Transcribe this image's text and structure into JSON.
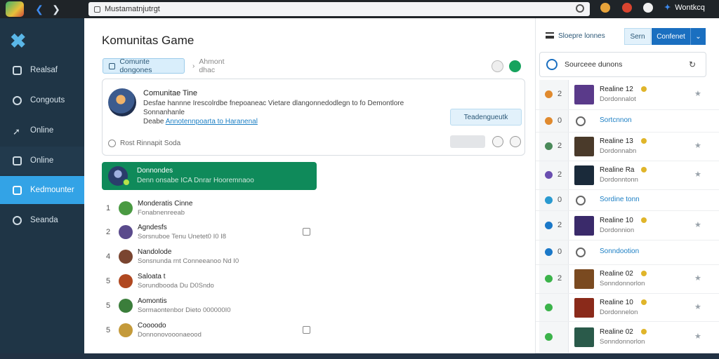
{
  "browser": {
    "url": "Mustamatnjutrgt",
    "extension_label": "Wontkcq",
    "accent": "#3d8bf0"
  },
  "sidebar": {
    "items": [
      {
        "label": "Realsaf",
        "icon": "document-icon"
      },
      {
        "label": "Congouts",
        "icon": "link-icon"
      },
      {
        "label": "Online",
        "icon": "rocket-icon"
      },
      {
        "label": "Online",
        "icon": "chat-icon"
      },
      {
        "label": "Kedmounter",
        "icon": "contacts-icon",
        "active": true
      },
      {
        "label": "Seanda",
        "icon": "clock-icon"
      }
    ],
    "active_color": "#33a3e6"
  },
  "main": {
    "title": "Komunitas Game",
    "tabs": [
      {
        "label": "Comunte dongones"
      },
      {
        "label": "Ahmont dhac"
      }
    ],
    "card": {
      "title": "Comunitae Tine",
      "text_line1": "Desfae hannne  Irescolrdbe  fnepoaneac  Vietare dlangonnedodlegn to  fo  Demontlore",
      "text_line2": "Sonnanhanle",
      "text_line3_prefix": "Deabe",
      "text_line3_link": "Annotennpoarta to  Haranenal",
      "button": "Teadengueutk",
      "footer": "Rost Rinnapit  Soda"
    },
    "banner": {
      "title": "Donnondes",
      "subtitle": "Denn onsabe  ICA  Dnrar  Hooremnaoo"
    },
    "leaderboard": [
      {
        "rank": "1",
        "name": "Monderatis Cinne",
        "sub": "Fonabnenreeab",
        "check": false
      },
      {
        "rank": "2",
        "name": "Agndesfs",
        "sub": "Sorsnuboe  Tenu  Unetet0  I0 I8",
        "check": true
      },
      {
        "rank": "4",
        "name": "Nandolode",
        "sub": "Sonsnunda  rnt  Conneeanoo  Nd  I0",
        "check": false
      },
      {
        "rank": "5",
        "name": "Saloata t",
        "sub": "Sorundbooda  Du  D0Sndo",
        "check": false
      },
      {
        "rank": "5",
        "name": "Aomontis",
        "sub": "Sormaontenbor  Dieto  000000I0",
        "check": false
      },
      {
        "rank": "5",
        "name": "Coooodo",
        "sub": "Donnonovooonaeood",
        "check": true
      }
    ]
  },
  "right_panel": {
    "title": "Sloepre lonnes",
    "segments": [
      "Sern",
      "Confenet",
      "⌄"
    ],
    "search_text": "Sourceee dunons",
    "events": [
      {
        "num": "2",
        "title": "Realine 12",
        "sub": "Dordonnalot",
        "link": false,
        "badge": true
      },
      {
        "num": "0",
        "title": "Sortcnnon",
        "sub": "",
        "link": true,
        "badge": false
      },
      {
        "num": "2",
        "title": "Realine 13",
        "sub": "Dordonnabn",
        "link": false,
        "badge": true
      },
      {
        "num": "2",
        "title": "Realine Ra",
        "sub": "Dordonntonn",
        "link": false,
        "badge": true
      },
      {
        "num": "0",
        "title": "Sordine tonn",
        "sub": "",
        "link": true,
        "badge": false
      },
      {
        "num": "2",
        "title": "Realine 10",
        "sub": "Dordonnion",
        "link": false,
        "badge": true
      },
      {
        "num": "0",
        "title": "Sonndootion",
        "sub": "",
        "link": true,
        "badge": false
      },
      {
        "num": "2",
        "title": "Realine 02",
        "sub": "Sonndonnorlon",
        "link": false,
        "badge": true
      },
      {
        "num": "",
        "title": "Realine 10",
        "sub": "Dordonnelon",
        "link": false,
        "badge": true
      },
      {
        "num": "",
        "title": "Realine 02",
        "sub": "Sonndonnorlon",
        "link": false,
        "badge": true
      }
    ]
  }
}
